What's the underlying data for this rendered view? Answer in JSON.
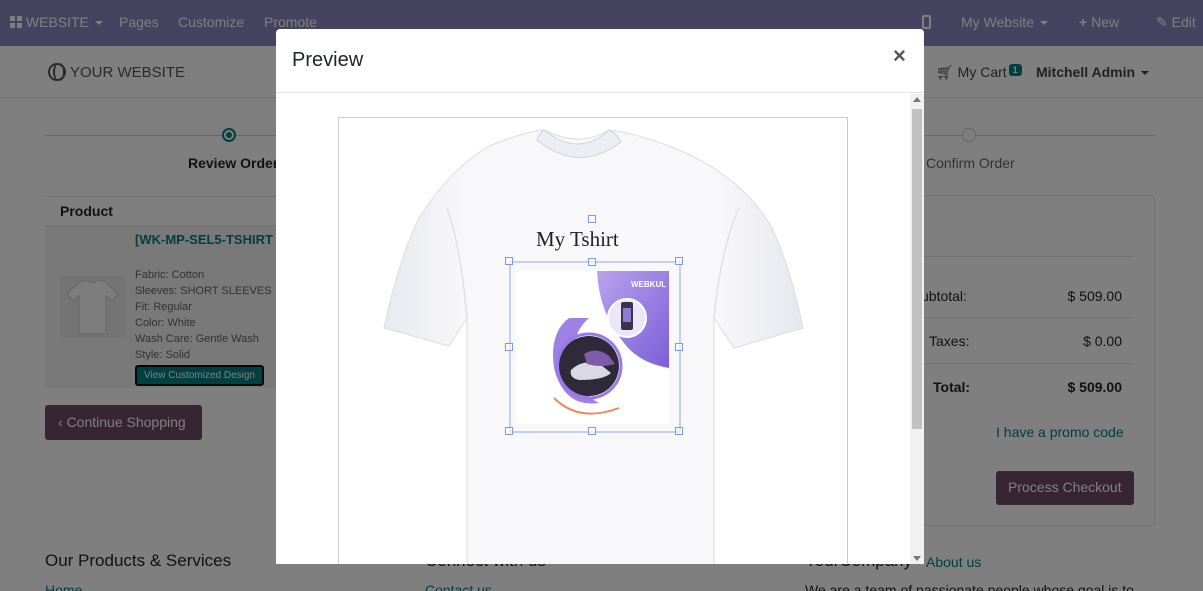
{
  "topbar": {
    "app_menu": "WEBSITE",
    "menu": [
      "Pages",
      "Customize",
      "Promote"
    ],
    "site_selector": "My Website",
    "new_label": "New",
    "edit_label": "Edit"
  },
  "header": {
    "logo": "YOUR WEBSITE",
    "cart_label": "My Cart",
    "cart_count": "1",
    "user": "Mitchell Admin"
  },
  "wizard": {
    "steps": [
      "Review Order",
      "Confirm Order"
    ]
  },
  "cart": {
    "column_header": "Product",
    "product_name": "[WK-MP-SEL5-TSHIRT",
    "attributes": [
      "Fabric: Cotton",
      "Sleeves: SHORT SLEEVES",
      "Fit: Regular",
      "Color: White",
      "Wash Care: Gentle Wash",
      "Style: Solid"
    ],
    "view_design_button": "View Customized Design",
    "continue_button": "Continue Shopping"
  },
  "summary": {
    "title_fragment": "]",
    "subtotal_label": "ubtotal:",
    "subtotal": "$ 509.00",
    "taxes_label": "Taxes:",
    "taxes": "$ 0.00",
    "total_label": "Total:",
    "total": "$ 509.00",
    "promo_link": "I have a promo code",
    "checkout_button": "Process Checkout"
  },
  "footer": {
    "col1_heading": "Our Products & Services",
    "col1_link": "Home",
    "col2_heading": "Connect with us",
    "col2_link": "Contact us",
    "col3_heading": "YourCompany",
    "col3_link": "About us",
    "col3_text": "We are a team of passionate people whose goal is to"
  },
  "modal": {
    "title": "Preview",
    "close": "×",
    "design_text": "My Tshirt",
    "logo_text": "WEBKUL"
  },
  "colors": {
    "admin_bar": "#8d86c1",
    "primary": "#714b67",
    "teal": "#017e84"
  }
}
